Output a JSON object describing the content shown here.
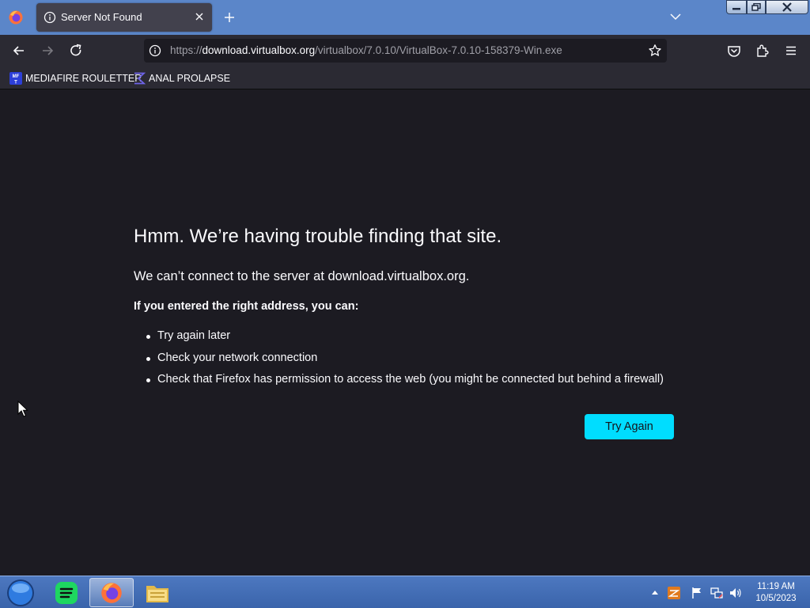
{
  "window": {
    "tab_title": "Server Not Found",
    "controls": [
      "minimize",
      "maximize",
      "close"
    ]
  },
  "navbar": {
    "url_prefix": "https://",
    "url_domain": "download.virtualbox.org",
    "url_path": "/virtualbox/7.0.10/VirtualBox-7.0.10-158379-Win.exe"
  },
  "bookmarks": [
    {
      "label": "MEDIAFIRE ROULETTER",
      "icon": "mediafire-icon"
    },
    {
      "label": "ANAL PROLAPSE",
      "icon": "sigma-icon"
    }
  ],
  "error": {
    "title": "Hmm. We’re having trouble finding that site.",
    "short_desc": "We can’t connect to the server at download.virtualbox.org.",
    "subheading": "If you entered the right address, you can:",
    "suggestions": [
      "Try again later",
      "Check your network connection",
      "Check that Firefox has permission to access the web (you might be connected but behind a firewall)"
    ],
    "button_label": "Try Again"
  },
  "taskbar": {
    "apps": [
      "start-orb",
      "spotify",
      "firefox",
      "file-explorer"
    ],
    "active_app": "firefox",
    "clock_time": "11:19 AM",
    "clock_date": "10/5/2023"
  },
  "colors": {
    "titlebar": "#5b86c9",
    "tab": "#42414d",
    "toolbar": "#2b2a33",
    "content_bg": "#1c1b22",
    "accent_button": "#00ddff",
    "taskbar": "#3a64ab"
  }
}
